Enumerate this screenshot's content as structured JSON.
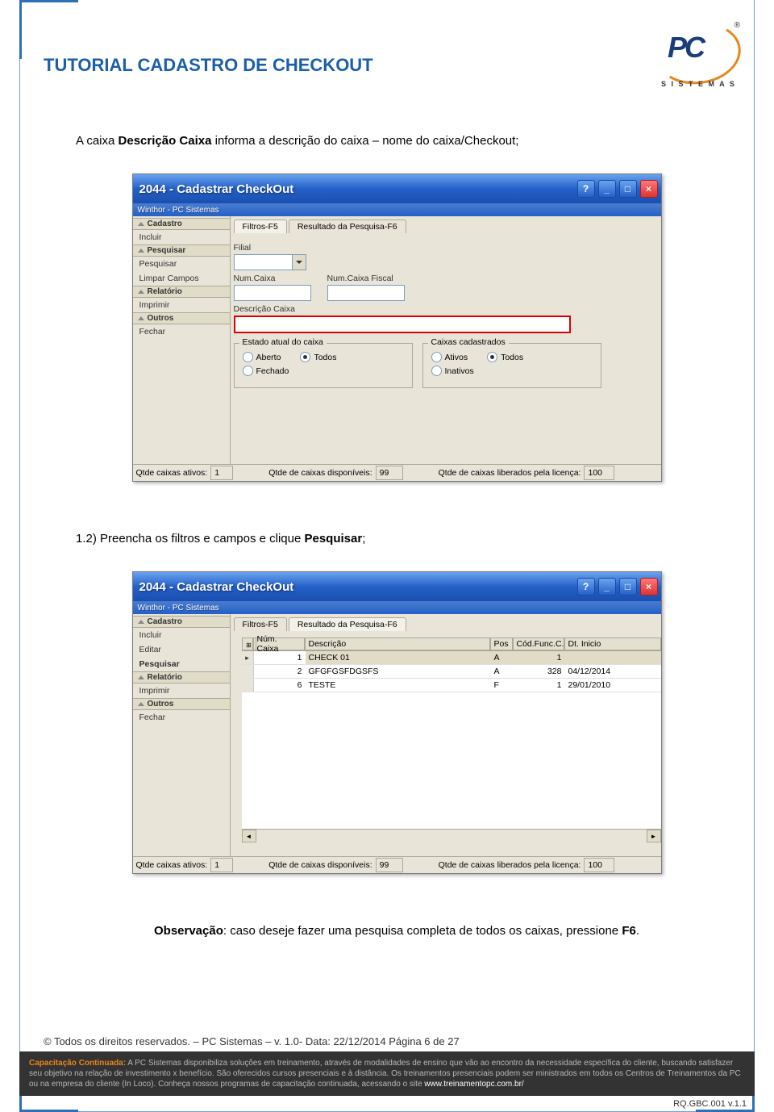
{
  "header": {
    "title": "TUTORIAL CADASTRO DE CHECKOUT",
    "logo_pc": "PC",
    "logo_sub": "S I S T E M A S",
    "logo_reg": "®"
  },
  "text": {
    "intro_pre": "A caixa ",
    "intro_bold": "Descrição Caixa",
    "intro_post": " informa a descrição do caixa – nome do caixa/Checkout;",
    "step_pre": "1.2) Preencha os filtros e campos e clique ",
    "step_bold": "Pesquisar",
    "step_post": ";",
    "obs_label": "Observação",
    "obs_pre": ": caso deseje fazer uma pesquisa completa de todos os caixas, pressione ",
    "obs_bold": "F6",
    "obs_post": "."
  },
  "window": {
    "title": "2044 - Cadastrar CheckOut",
    "subtitle": "Winthor - PC Sistemas",
    "tabs": {
      "filtros": "Filtros-F5",
      "resultado": "Resultado da Pesquisa-F6"
    },
    "labels": {
      "filial": "Filial",
      "numcaixa": "Num.Caixa",
      "numcaixafiscal": "Num.Caixa Fiscal",
      "desc": "Descrição Caixa",
      "estado": "Estado atual do caixa",
      "caixas_cad": "Caixas cadastrados"
    },
    "radios": {
      "aberto": "Aberto",
      "todos": "Todos",
      "fechado": "Fechado",
      "ativos": "Ativos",
      "inativos": "Inativos"
    },
    "sidebar1": {
      "cadastro": "Cadastro",
      "incluir": "Incluir",
      "pesquisar_h": "Pesquisar",
      "pesquisar": "Pesquisar",
      "limpar": "Limpar Campos",
      "relatorio": "Relatório",
      "imprimir": "Imprimir",
      "outros": "Outros",
      "fechar": "Fechar"
    },
    "sidebar2": {
      "cadastro": "Cadastro",
      "incluir": "Incluir",
      "editar": "Editar",
      "pesquisar": "Pesquisar",
      "relatorio": "Relatório",
      "imprimir": "Imprimir",
      "outros": "Outros",
      "fechar": "Fechar"
    },
    "status": {
      "l1": "Qtde caixas ativos:",
      "v1": "1",
      "l2": "Qtde de caixas disponíveis:",
      "v2": "99",
      "l3": "Qtde de caixas liberados pela licença:",
      "v3": "100"
    },
    "table": {
      "headers": {
        "num": "Núm. Caixa",
        "desc": "Descrição",
        "pos": "Pos",
        "cod": "Cód.Func.C.",
        "dt": "Dt. Inicio"
      },
      "rows": [
        {
          "num": "1",
          "desc": "CHECK 01",
          "pos": "A",
          "cod": "1",
          "dt": ""
        },
        {
          "num": "2",
          "desc": "GFGFGSFDGSFS",
          "pos": "A",
          "cod": "328",
          "dt": "04/12/2014"
        },
        {
          "num": "6",
          "desc": "TESTE",
          "pos": "F",
          "cod": "1",
          "dt": "29/01/2010"
        }
      ]
    }
  },
  "footer": {
    "copyright": "© Todos os direitos reservados. – PC Sistemas – v. 1.0- Data: 22/12/2014  Página 6 de 27",
    "bar_title": "Capacitação Continuada:",
    "bar_text": " A PC Sistemas disponibiliza soluções em treinamento, através de modalidades de ensino que vão ao encontro da necessidade específica do cliente, buscando satisfazer seu objetivo na relação de investimento x benefício. São oferecidos cursos presenciais e à distância. Os treinamentos presenciais podem ser ministrados em todos os Centros de Treinamentos da PC ou na empresa do cliente (In Loco). Conheça nossos programas de capacitação continuada, acessando o site ",
    "bar_link": "www.treinamentopc.com.br/",
    "doc_id": "RQ.GBC.001 v.1.1"
  }
}
